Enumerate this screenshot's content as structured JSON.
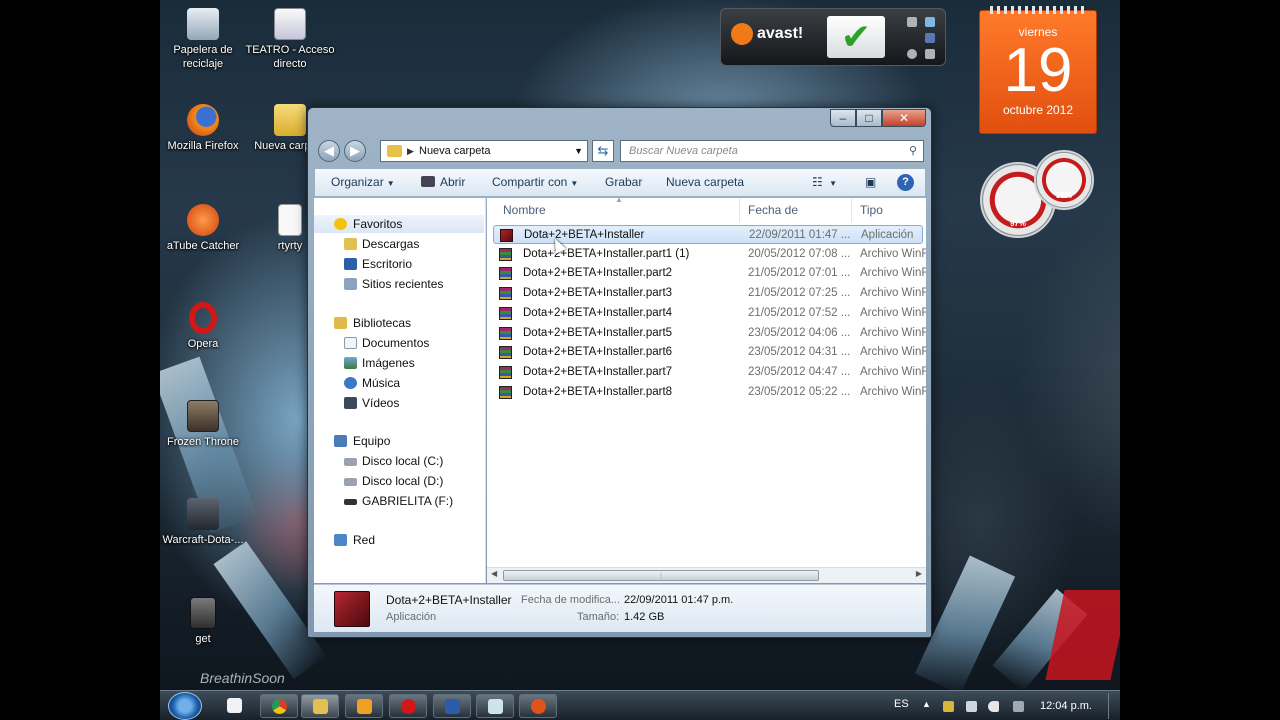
{
  "desktop": {
    "icons": [
      {
        "label": "Papelera de reciclaje",
        "color": "#b9c7d3"
      },
      {
        "label": "TEATRO - Acceso directo",
        "color": "#d9d9e8"
      },
      {
        "label": "Mozilla Firefox",
        "color": "#e56a1f"
      },
      {
        "label": "Nueva carpeta",
        "color": "#e3c14a"
      },
      {
        "label": "aTube Catcher",
        "color": "#e0541a"
      },
      {
        "label": "rtyrty",
        "color": "#f2f2f2"
      },
      {
        "label": "Opera",
        "color": "#d01818"
      },
      {
        "label": "Frozen Throne",
        "color": "#5a4a3a"
      },
      {
        "label": "Warcraft-Dota-...",
        "color": "#3a3f48"
      },
      {
        "label": "get",
        "color": "#4a4a4a"
      }
    ],
    "signature": "BreathinSoon"
  },
  "gadgets": {
    "avast_label": "avast!",
    "calendar": {
      "weekday": "viernes",
      "day": "19",
      "month_year": "octubre 2012"
    },
    "cpu": "97%",
    "ram": "38%"
  },
  "window": {
    "address": "Nueva carpeta",
    "search_placeholder": "Buscar Nueva carpeta",
    "toolbar": {
      "organize": "Organizar",
      "open": "Abrir",
      "share": "Compartir con",
      "burn": "Grabar",
      "new_folder": "Nueva carpeta"
    },
    "nav": {
      "favorites": "Favoritos",
      "downloads": "Descargas",
      "desktop": "Escritorio",
      "recent": "Sitios recientes",
      "libraries": "Bibliotecas",
      "documents": "Documentos",
      "images": "Imágenes",
      "music": "Música",
      "videos": "Vídeos",
      "computer": "Equipo",
      "disk_c": "Disco local (C:)",
      "disk_d": "Disco local (D:)",
      "usb_f": "GABRIELITA (F:)",
      "network": "Red"
    },
    "columns": {
      "name": "Nombre",
      "date": "Fecha de modifica...",
      "type": "Tipo"
    },
    "files": [
      {
        "name": "Dota+2+BETA+Installer",
        "date": "22/09/2011 01:47 ...",
        "type": "Aplicación",
        "kind": "exe"
      },
      {
        "name": "Dota+2+BETA+Installer.part1 (1)",
        "date": "20/05/2012 07:08 ...",
        "type": "Archivo WinRAR",
        "kind": "rar"
      },
      {
        "name": "Dota+2+BETA+Installer.part2",
        "date": "21/05/2012 07:01 ...",
        "type": "Archivo WinRAR",
        "kind": "rar"
      },
      {
        "name": "Dota+2+BETA+Installer.part3",
        "date": "21/05/2012 07:25 ...",
        "type": "Archivo WinRAR",
        "kind": "rar"
      },
      {
        "name": "Dota+2+BETA+Installer.part4",
        "date": "21/05/2012 07:52 ...",
        "type": "Archivo WinRAR",
        "kind": "rar"
      },
      {
        "name": "Dota+2+BETA+Installer.part5",
        "date": "23/05/2012 04:06 ...",
        "type": "Archivo WinRAR",
        "kind": "rar"
      },
      {
        "name": "Dota+2+BETA+Installer.part6",
        "date": "23/05/2012 04:31 ...",
        "type": "Archivo WinRAR",
        "kind": "rar"
      },
      {
        "name": "Dota+2+BETA+Installer.part7",
        "date": "23/05/2012 04:47 ...",
        "type": "Archivo WinRAR",
        "kind": "rar"
      },
      {
        "name": "Dota+2+BETA+Installer.part8",
        "date": "23/05/2012 05:22 ...",
        "type": "Archivo WinRAR",
        "kind": "rar"
      }
    ],
    "details": {
      "name": "Dota+2+BETA+Installer",
      "kind": "Aplicación",
      "date_label": "Fecha de modifica...",
      "date_value": "22/09/2011 01:47 p.m.",
      "size_label": "Tamaño:",
      "size_value": "1.42 GB"
    }
  },
  "taskbar": {
    "language": "ES",
    "time": "12:04 p.m."
  }
}
